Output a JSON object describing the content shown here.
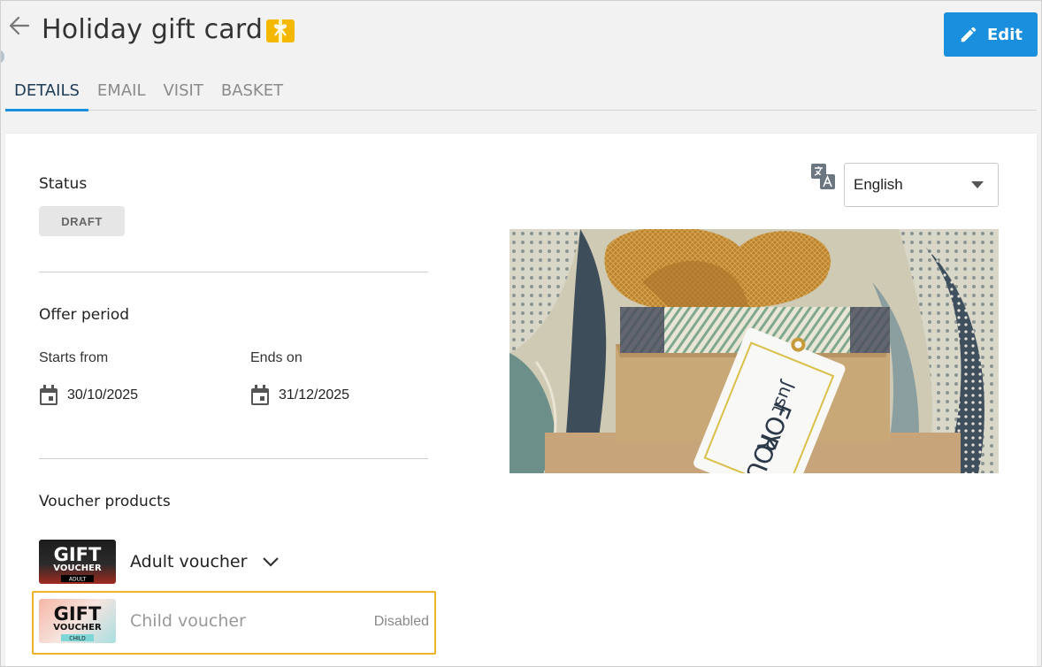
{
  "header": {
    "title": "Holiday gift card",
    "edit_label": "Edit"
  },
  "tabs": [
    {
      "label": "DETAILS",
      "active": true
    },
    {
      "label": "EMAIL",
      "active": false
    },
    {
      "label": "VISIT",
      "active": false
    },
    {
      "label": "BASKET",
      "active": false
    }
  ],
  "status": {
    "label": "Status",
    "badge": "DRAFT"
  },
  "offer_period": {
    "label": "Offer period",
    "starts_label": "Starts from",
    "starts_value": "30/10/2025",
    "ends_label": "Ends on",
    "ends_value": "31/12/2025"
  },
  "vouchers": {
    "label": "Voucher products",
    "items": [
      {
        "name": "Adult voucher",
        "thumb_title": "GIFT",
        "thumb_sub": "VOUCHER",
        "thumb_tag": "ADULT",
        "status": ""
      },
      {
        "name": "Child voucher",
        "thumb_title": "GIFT",
        "thumb_sub": "VOUCHER",
        "thumb_tag": "CHILD",
        "status": "Disabled"
      }
    ]
  },
  "language": {
    "selected": "English"
  },
  "hero": {
    "tag_line1": "Just",
    "tag_line2": "FOR",
    "tag_line3": "YOU"
  },
  "colors": {
    "accent": "#1a8fde",
    "highlight_border": "#f0b429",
    "gift_icon": "#f5b800"
  }
}
